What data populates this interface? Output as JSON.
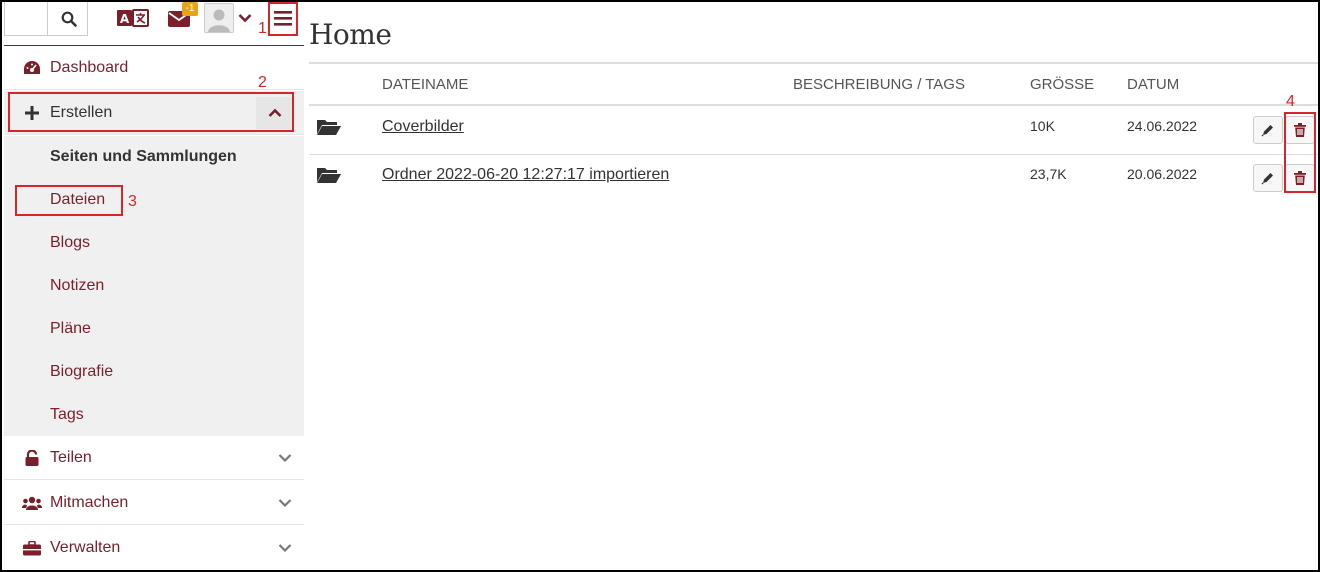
{
  "header": {
    "search_icon": "search-icon",
    "language_icon": "language-icon",
    "mail_icon": "mail-icon",
    "mail_badge": "-1",
    "user_icon": "user-avatar-icon",
    "menu_icon": "hamburger-menu-icon"
  },
  "annotations": {
    "n1": "1",
    "n2": "2",
    "n3": "3",
    "n4": "4"
  },
  "sidebar": {
    "dashboard": "Dashboard",
    "create": "Erstellen",
    "create_sub": [
      "Seiten und Sammlungen",
      "Dateien",
      "Blogs",
      "Notizen",
      "Pläne",
      "Biografie",
      "Tags"
    ],
    "share": "Teilen",
    "participate": "Mitmachen",
    "manage": "Verwalten"
  },
  "main": {
    "title": "Home",
    "columns": {
      "name": "Dateiname",
      "description": "Beschreibung / Tags",
      "size": "Grösse",
      "date": "Datum"
    },
    "rows": [
      {
        "name": "Coverbilder",
        "size": "10K",
        "date": "24.06.2022"
      },
      {
        "name": "Ordner 2022-06-20 12:27:17 importieren",
        "size": "23,7K",
        "date": "20.06.2022"
      }
    ]
  },
  "colors": {
    "brand": "#7a1f2b",
    "annotation": "#d6262b",
    "badge": "#e8a317"
  }
}
